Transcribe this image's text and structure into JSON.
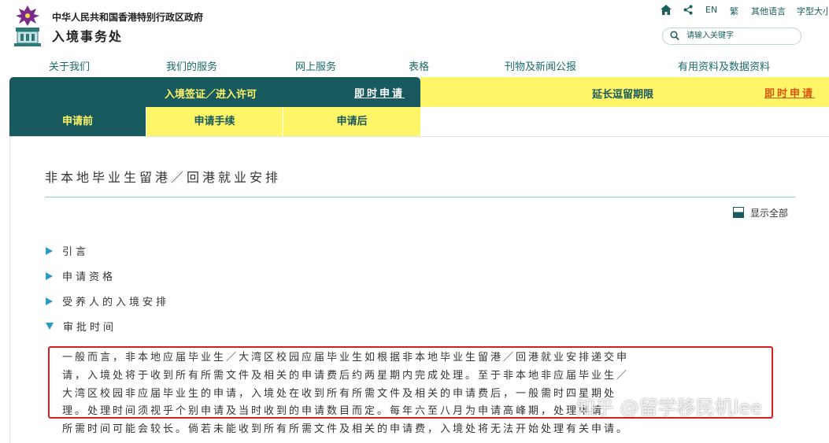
{
  "header": {
    "gov_name": "中华人民共和国香港特别行政区政府",
    "dept_name": "入境事务处",
    "utility": {
      "home_icon": "home-icon",
      "share_icon": "share-icon",
      "lang_en": "EN",
      "lang_trad": "繁",
      "other_lang": "其他语言",
      "font_size": "字型大小"
    },
    "search": {
      "placeholder": "请输入关键字",
      "icon": "search-icon"
    }
  },
  "main_nav": [
    "关于我们",
    "我们的服务",
    "网上服务",
    "表格",
    "刊物及新闻公报",
    "有用资料及数据资料"
  ],
  "tabs": {
    "left": {
      "label": "入境签证／进入许可",
      "apply": "即时申请"
    },
    "right": {
      "label": "延长逗留期限",
      "apply": "即时申请"
    }
  },
  "sub_tabs": [
    "申请前",
    "申请手续",
    "申请后"
  ],
  "page": {
    "title": "非本地毕业生留港／回港就业安排",
    "show_all": "显示全部",
    "sections": [
      {
        "label": "引言",
        "expanded": false
      },
      {
        "label": "申请资格",
        "expanded": false
      },
      {
        "label": "受养人的入境安排",
        "expanded": false
      },
      {
        "label": "审批时间",
        "expanded": true
      }
    ],
    "body_lines": [
      "一般而言，非本地应届毕业生／大湾区校园应届毕业生如根据非本地毕业生留港／回港就业安排递交申",
      "请，入境处将于收到所有所需文件及相关的申请费后约两星期内完成处理。至于非本地非应届毕业生／",
      "大湾区校园非应届毕业生的申请，入境处在收到所有所需文件及相关的申请费后，一般需时四星期处",
      "理。处理时间须视乎个别申请及当时收到的申请数目而定。每年六至八月为申请高峰期，处理申请",
      "所需时间可能会较长。倘若未能收到所有所需文件及相关的申请费，入境处将无法开始处理有关申请。"
    ]
  },
  "watermark": "知乎 @留学移民机lee",
  "colors": {
    "teal": "#17595d",
    "yellow": "#fff568",
    "link_teal": "#1b6b6b",
    "apply_orange": "#d9540f",
    "triangle": "#2a9ac0",
    "highlight_red": "#d61f1f"
  }
}
